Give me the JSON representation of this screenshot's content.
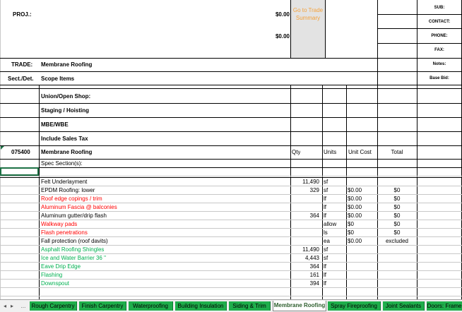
{
  "header": {
    "proj_label": "PROJ.:",
    "amount1": "$0.00",
    "amount2": "$0.00",
    "link_line1": "Go to Trade",
    "link_line2": "Summary",
    "sub_label": "SUB:",
    "contact_label": "CONTACT:",
    "phone_label": "PHONE:",
    "fax_label": "FAX:",
    "notes_label": "Notes:",
    "basebid_label": "Base Bid:",
    "trade_label": "TRADE:",
    "trade_value": "Membrane Roofing",
    "sectdet_label": "Sect./Det.",
    "scope_label": "Scope Items"
  },
  "sections": {
    "union": "Union/Open Shop:",
    "staging": "Staging / Hoisting",
    "mbe": "MBE/WBE",
    "tax": "Include Sales Tax"
  },
  "table": {
    "code": "075400",
    "title": "Membrane Roofing",
    "col_qty": "Qty",
    "col_units": "Units",
    "col_unit_cost": "Unit Cost",
    "col_total": "Total",
    "spec": "Spec Section(s):",
    "rows": [
      {
        "item": "Felt Underlayment",
        "qty": "11,490",
        "units": "sf",
        "cost": "",
        "total": "",
        "color": "black"
      },
      {
        "item": "EPDM Roofing:  lower",
        "qty": "329",
        "units": "sf",
        "cost": "$0.00",
        "total": "$0",
        "color": "black"
      },
      {
        "item": "Roof edge copings / trim",
        "qty": "",
        "units": "lf",
        "cost": "$0.00",
        "total": "$0",
        "color": "red"
      },
      {
        "item": "Aluminum Fascia @ balconies",
        "qty": "",
        "units": "lf",
        "cost": "$0.00",
        "total": "$0",
        "color": "red"
      },
      {
        "item": "Aluminum gutter/drip flash",
        "qty": "364",
        "units": "lf",
        "cost": "$0.00",
        "total": "$0",
        "color": "black"
      },
      {
        "item": "Walkway pads",
        "qty": "",
        "units": "allow",
        "cost": "$0",
        "total": "$0",
        "color": "red"
      },
      {
        "item": "Flash penetrations",
        "qty": "",
        "units": "ls",
        "cost": "$0",
        "total": "$0",
        "color": "red"
      },
      {
        "item": "Fall protection (roof davits)",
        "qty": "",
        "units": "ea",
        "cost": "$0.00",
        "total": "excluded",
        "color": "black"
      },
      {
        "item": "Asphalt Roofing Shingles",
        "qty": "11,490",
        "units": "sf",
        "cost": "",
        "total": "",
        "color": "green"
      },
      {
        "item": "Ice and Water Barrier 36 \"",
        "qty": "4,443",
        "units": "sf",
        "cost": "",
        "total": "",
        "color": "green"
      },
      {
        "item": "Eave Drip Edge",
        "qty": "364",
        "units": "lf",
        "cost": "",
        "total": "",
        "color": "green"
      },
      {
        "item": "Flashing",
        "qty": "161",
        "units": "lf",
        "cost": "",
        "total": "",
        "color": "green"
      },
      {
        "item": "Downspout",
        "qty": "394",
        "units": "lf",
        "cost": "",
        "total": "",
        "color": "green"
      }
    ]
  },
  "tabs": {
    "nav_prev": "◂",
    "nav_next": "▸",
    "ellipsis": "...",
    "items": [
      "Rough Carpentry",
      "Finish Carpentry",
      "Waterproofing",
      "Building Insulation",
      "Siding & Trim",
      "Membrane Roofing",
      "Spray Fireproofing",
      "Joint Sealants",
      "Doors: Frame"
    ],
    "active_index": 5
  }
}
